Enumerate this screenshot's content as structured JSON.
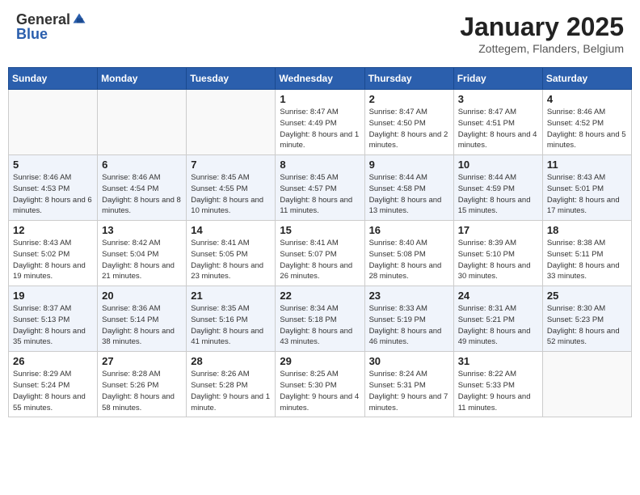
{
  "header": {
    "logo_general": "General",
    "logo_blue": "Blue",
    "title": "January 2025",
    "location": "Zottegem, Flanders, Belgium"
  },
  "days_of_week": [
    "Sunday",
    "Monday",
    "Tuesday",
    "Wednesday",
    "Thursday",
    "Friday",
    "Saturday"
  ],
  "weeks": [
    [
      {
        "day": "",
        "sunrise": "",
        "sunset": "",
        "daylight": "",
        "empty": true
      },
      {
        "day": "",
        "sunrise": "",
        "sunset": "",
        "daylight": "",
        "empty": true
      },
      {
        "day": "",
        "sunrise": "",
        "sunset": "",
        "daylight": "",
        "empty": true
      },
      {
        "day": "1",
        "sunrise": "Sunrise: 8:47 AM",
        "sunset": "Sunset: 4:49 PM",
        "daylight": "Daylight: 8 hours and 1 minute.",
        "empty": false
      },
      {
        "day": "2",
        "sunrise": "Sunrise: 8:47 AM",
        "sunset": "Sunset: 4:50 PM",
        "daylight": "Daylight: 8 hours and 2 minutes.",
        "empty": false
      },
      {
        "day": "3",
        "sunrise": "Sunrise: 8:47 AM",
        "sunset": "Sunset: 4:51 PM",
        "daylight": "Daylight: 8 hours and 4 minutes.",
        "empty": false
      },
      {
        "day": "4",
        "sunrise": "Sunrise: 8:46 AM",
        "sunset": "Sunset: 4:52 PM",
        "daylight": "Daylight: 8 hours and 5 minutes.",
        "empty": false
      }
    ],
    [
      {
        "day": "5",
        "sunrise": "Sunrise: 8:46 AM",
        "sunset": "Sunset: 4:53 PM",
        "daylight": "Daylight: 8 hours and 6 minutes.",
        "empty": false
      },
      {
        "day": "6",
        "sunrise": "Sunrise: 8:46 AM",
        "sunset": "Sunset: 4:54 PM",
        "daylight": "Daylight: 8 hours and 8 minutes.",
        "empty": false
      },
      {
        "day": "7",
        "sunrise": "Sunrise: 8:45 AM",
        "sunset": "Sunset: 4:55 PM",
        "daylight": "Daylight: 8 hours and 10 minutes.",
        "empty": false
      },
      {
        "day": "8",
        "sunrise": "Sunrise: 8:45 AM",
        "sunset": "Sunset: 4:57 PM",
        "daylight": "Daylight: 8 hours and 11 minutes.",
        "empty": false
      },
      {
        "day": "9",
        "sunrise": "Sunrise: 8:44 AM",
        "sunset": "Sunset: 4:58 PM",
        "daylight": "Daylight: 8 hours and 13 minutes.",
        "empty": false
      },
      {
        "day": "10",
        "sunrise": "Sunrise: 8:44 AM",
        "sunset": "Sunset: 4:59 PM",
        "daylight": "Daylight: 8 hours and 15 minutes.",
        "empty": false
      },
      {
        "day": "11",
        "sunrise": "Sunrise: 8:43 AM",
        "sunset": "Sunset: 5:01 PM",
        "daylight": "Daylight: 8 hours and 17 minutes.",
        "empty": false
      }
    ],
    [
      {
        "day": "12",
        "sunrise": "Sunrise: 8:43 AM",
        "sunset": "Sunset: 5:02 PM",
        "daylight": "Daylight: 8 hours and 19 minutes.",
        "empty": false
      },
      {
        "day": "13",
        "sunrise": "Sunrise: 8:42 AM",
        "sunset": "Sunset: 5:04 PM",
        "daylight": "Daylight: 8 hours and 21 minutes.",
        "empty": false
      },
      {
        "day": "14",
        "sunrise": "Sunrise: 8:41 AM",
        "sunset": "Sunset: 5:05 PM",
        "daylight": "Daylight: 8 hours and 23 minutes.",
        "empty": false
      },
      {
        "day": "15",
        "sunrise": "Sunrise: 8:41 AM",
        "sunset": "Sunset: 5:07 PM",
        "daylight": "Daylight: 8 hours and 26 minutes.",
        "empty": false
      },
      {
        "day": "16",
        "sunrise": "Sunrise: 8:40 AM",
        "sunset": "Sunset: 5:08 PM",
        "daylight": "Daylight: 8 hours and 28 minutes.",
        "empty": false
      },
      {
        "day": "17",
        "sunrise": "Sunrise: 8:39 AM",
        "sunset": "Sunset: 5:10 PM",
        "daylight": "Daylight: 8 hours and 30 minutes.",
        "empty": false
      },
      {
        "day": "18",
        "sunrise": "Sunrise: 8:38 AM",
        "sunset": "Sunset: 5:11 PM",
        "daylight": "Daylight: 8 hours and 33 minutes.",
        "empty": false
      }
    ],
    [
      {
        "day": "19",
        "sunrise": "Sunrise: 8:37 AM",
        "sunset": "Sunset: 5:13 PM",
        "daylight": "Daylight: 8 hours and 35 minutes.",
        "empty": false
      },
      {
        "day": "20",
        "sunrise": "Sunrise: 8:36 AM",
        "sunset": "Sunset: 5:14 PM",
        "daylight": "Daylight: 8 hours and 38 minutes.",
        "empty": false
      },
      {
        "day": "21",
        "sunrise": "Sunrise: 8:35 AM",
        "sunset": "Sunset: 5:16 PM",
        "daylight": "Daylight: 8 hours and 41 minutes.",
        "empty": false
      },
      {
        "day": "22",
        "sunrise": "Sunrise: 8:34 AM",
        "sunset": "Sunset: 5:18 PM",
        "daylight": "Daylight: 8 hours and 43 minutes.",
        "empty": false
      },
      {
        "day": "23",
        "sunrise": "Sunrise: 8:33 AM",
        "sunset": "Sunset: 5:19 PM",
        "daylight": "Daylight: 8 hours and 46 minutes.",
        "empty": false
      },
      {
        "day": "24",
        "sunrise": "Sunrise: 8:31 AM",
        "sunset": "Sunset: 5:21 PM",
        "daylight": "Daylight: 8 hours and 49 minutes.",
        "empty": false
      },
      {
        "day": "25",
        "sunrise": "Sunrise: 8:30 AM",
        "sunset": "Sunset: 5:23 PM",
        "daylight": "Daylight: 8 hours and 52 minutes.",
        "empty": false
      }
    ],
    [
      {
        "day": "26",
        "sunrise": "Sunrise: 8:29 AM",
        "sunset": "Sunset: 5:24 PM",
        "daylight": "Daylight: 8 hours and 55 minutes.",
        "empty": false
      },
      {
        "day": "27",
        "sunrise": "Sunrise: 8:28 AM",
        "sunset": "Sunset: 5:26 PM",
        "daylight": "Daylight: 8 hours and 58 minutes.",
        "empty": false
      },
      {
        "day": "28",
        "sunrise": "Sunrise: 8:26 AM",
        "sunset": "Sunset: 5:28 PM",
        "daylight": "Daylight: 9 hours and 1 minute.",
        "empty": false
      },
      {
        "day": "29",
        "sunrise": "Sunrise: 8:25 AM",
        "sunset": "Sunset: 5:30 PM",
        "daylight": "Daylight: 9 hours and 4 minutes.",
        "empty": false
      },
      {
        "day": "30",
        "sunrise": "Sunrise: 8:24 AM",
        "sunset": "Sunset: 5:31 PM",
        "daylight": "Daylight: 9 hours and 7 minutes.",
        "empty": false
      },
      {
        "day": "31",
        "sunrise": "Sunrise: 8:22 AM",
        "sunset": "Sunset: 5:33 PM",
        "daylight": "Daylight: 9 hours and 11 minutes.",
        "empty": false
      },
      {
        "day": "",
        "sunrise": "",
        "sunset": "",
        "daylight": "",
        "empty": true
      }
    ]
  ]
}
